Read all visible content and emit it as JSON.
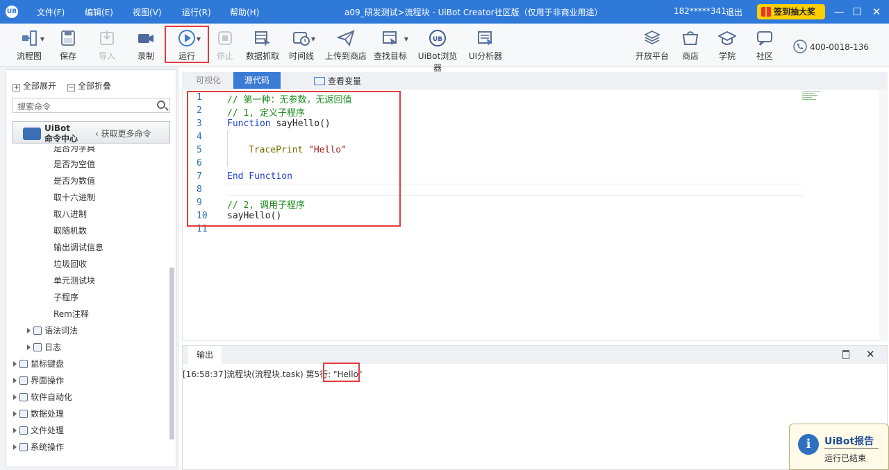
{
  "titlebar": {
    "logo": "UB",
    "menus": [
      "文件(F)",
      "编辑(E)",
      "视图(V)",
      "运行(R)",
      "帮助(H)"
    ],
    "title": "a09_研发测试>流程块 - UiBot Creator社区版（仅用于非商业用途）",
    "account": "182*****341",
    "logout": "退出",
    "signin": "签到抽大奖"
  },
  "toolbar": {
    "items": [
      {
        "label": "流程图",
        "icon": "flowchart-icon"
      },
      {
        "label": "保存",
        "icon": "save-icon"
      },
      {
        "label": "导入",
        "icon": "import-icon",
        "disabled": true
      },
      {
        "label": "录制",
        "icon": "record-icon"
      },
      {
        "label": "运行",
        "icon": "run-icon"
      },
      {
        "label": "停止",
        "icon": "stop-icon",
        "disabled": true
      },
      {
        "label": "数据抓取",
        "icon": "data-scrape-icon"
      },
      {
        "label": "时间线",
        "icon": "timeline-icon"
      },
      {
        "label": "上传到商店",
        "icon": "upload-icon"
      },
      {
        "label": "查找目标",
        "icon": "find-target-icon"
      },
      {
        "label": "UiBot浏览器",
        "icon": "browser-icon"
      },
      {
        "label": "UI分析器",
        "icon": "ui-analyzer-icon"
      }
    ],
    "right": [
      {
        "label": "开放平台",
        "icon": "open-platform-icon"
      },
      {
        "label": "商店",
        "icon": "store-icon"
      },
      {
        "label": "学院",
        "icon": "academy-icon"
      },
      {
        "label": "社区",
        "icon": "community-icon"
      }
    ],
    "phone": "400-0018-136"
  },
  "left": {
    "expand_all": "全部展开",
    "collapse_all": "全部折叠",
    "search_placeholder": "搜索命令",
    "cmd_center_line1": "UiBot",
    "cmd_center_line2": "命令中心",
    "get_more": "获取更多命令",
    "partial_top": "是否为字典",
    "sub_items": [
      "是否为空值",
      "是否为数值",
      "取十六进制",
      "取八进制",
      "取随机数",
      "输出调试信息",
      "垃圾回收",
      "单元测试块",
      "子程序",
      "Rem注释"
    ],
    "group_items": [
      {
        "label": "语法词法"
      },
      {
        "label": "日志"
      }
    ],
    "categories": [
      "鼠标键盘",
      "界面操作",
      "软件自动化",
      "数据处理",
      "文件处理",
      "系统操作"
    ]
  },
  "editor": {
    "tab_visual": "可视化",
    "tab_source": "源代码",
    "view_vars": "查看变量",
    "line_numbers": [
      "1",
      "2",
      "3",
      "4",
      "5",
      "6",
      "7",
      "8",
      "9",
      "10",
      "11"
    ],
    "lines": {
      "l1": "// 第一种：无参数，无返回值",
      "l2": "// 1, 定义子程序",
      "l3_kw": "Function",
      "l3_rest": " sayHello()",
      "l5_fn": "TracePrint",
      "l5_str": " \"Hello\"",
      "l7": "End Function",
      "l9": "// 2, 调用子程序",
      "l10": "sayHello()"
    }
  },
  "output": {
    "tab": "输出",
    "log": "[16:58:37]流程块(流程块.task) 第5行: ",
    "value": "\"Hello\""
  },
  "report": {
    "title": "UiBot报告",
    "status": "运行已结束"
  }
}
